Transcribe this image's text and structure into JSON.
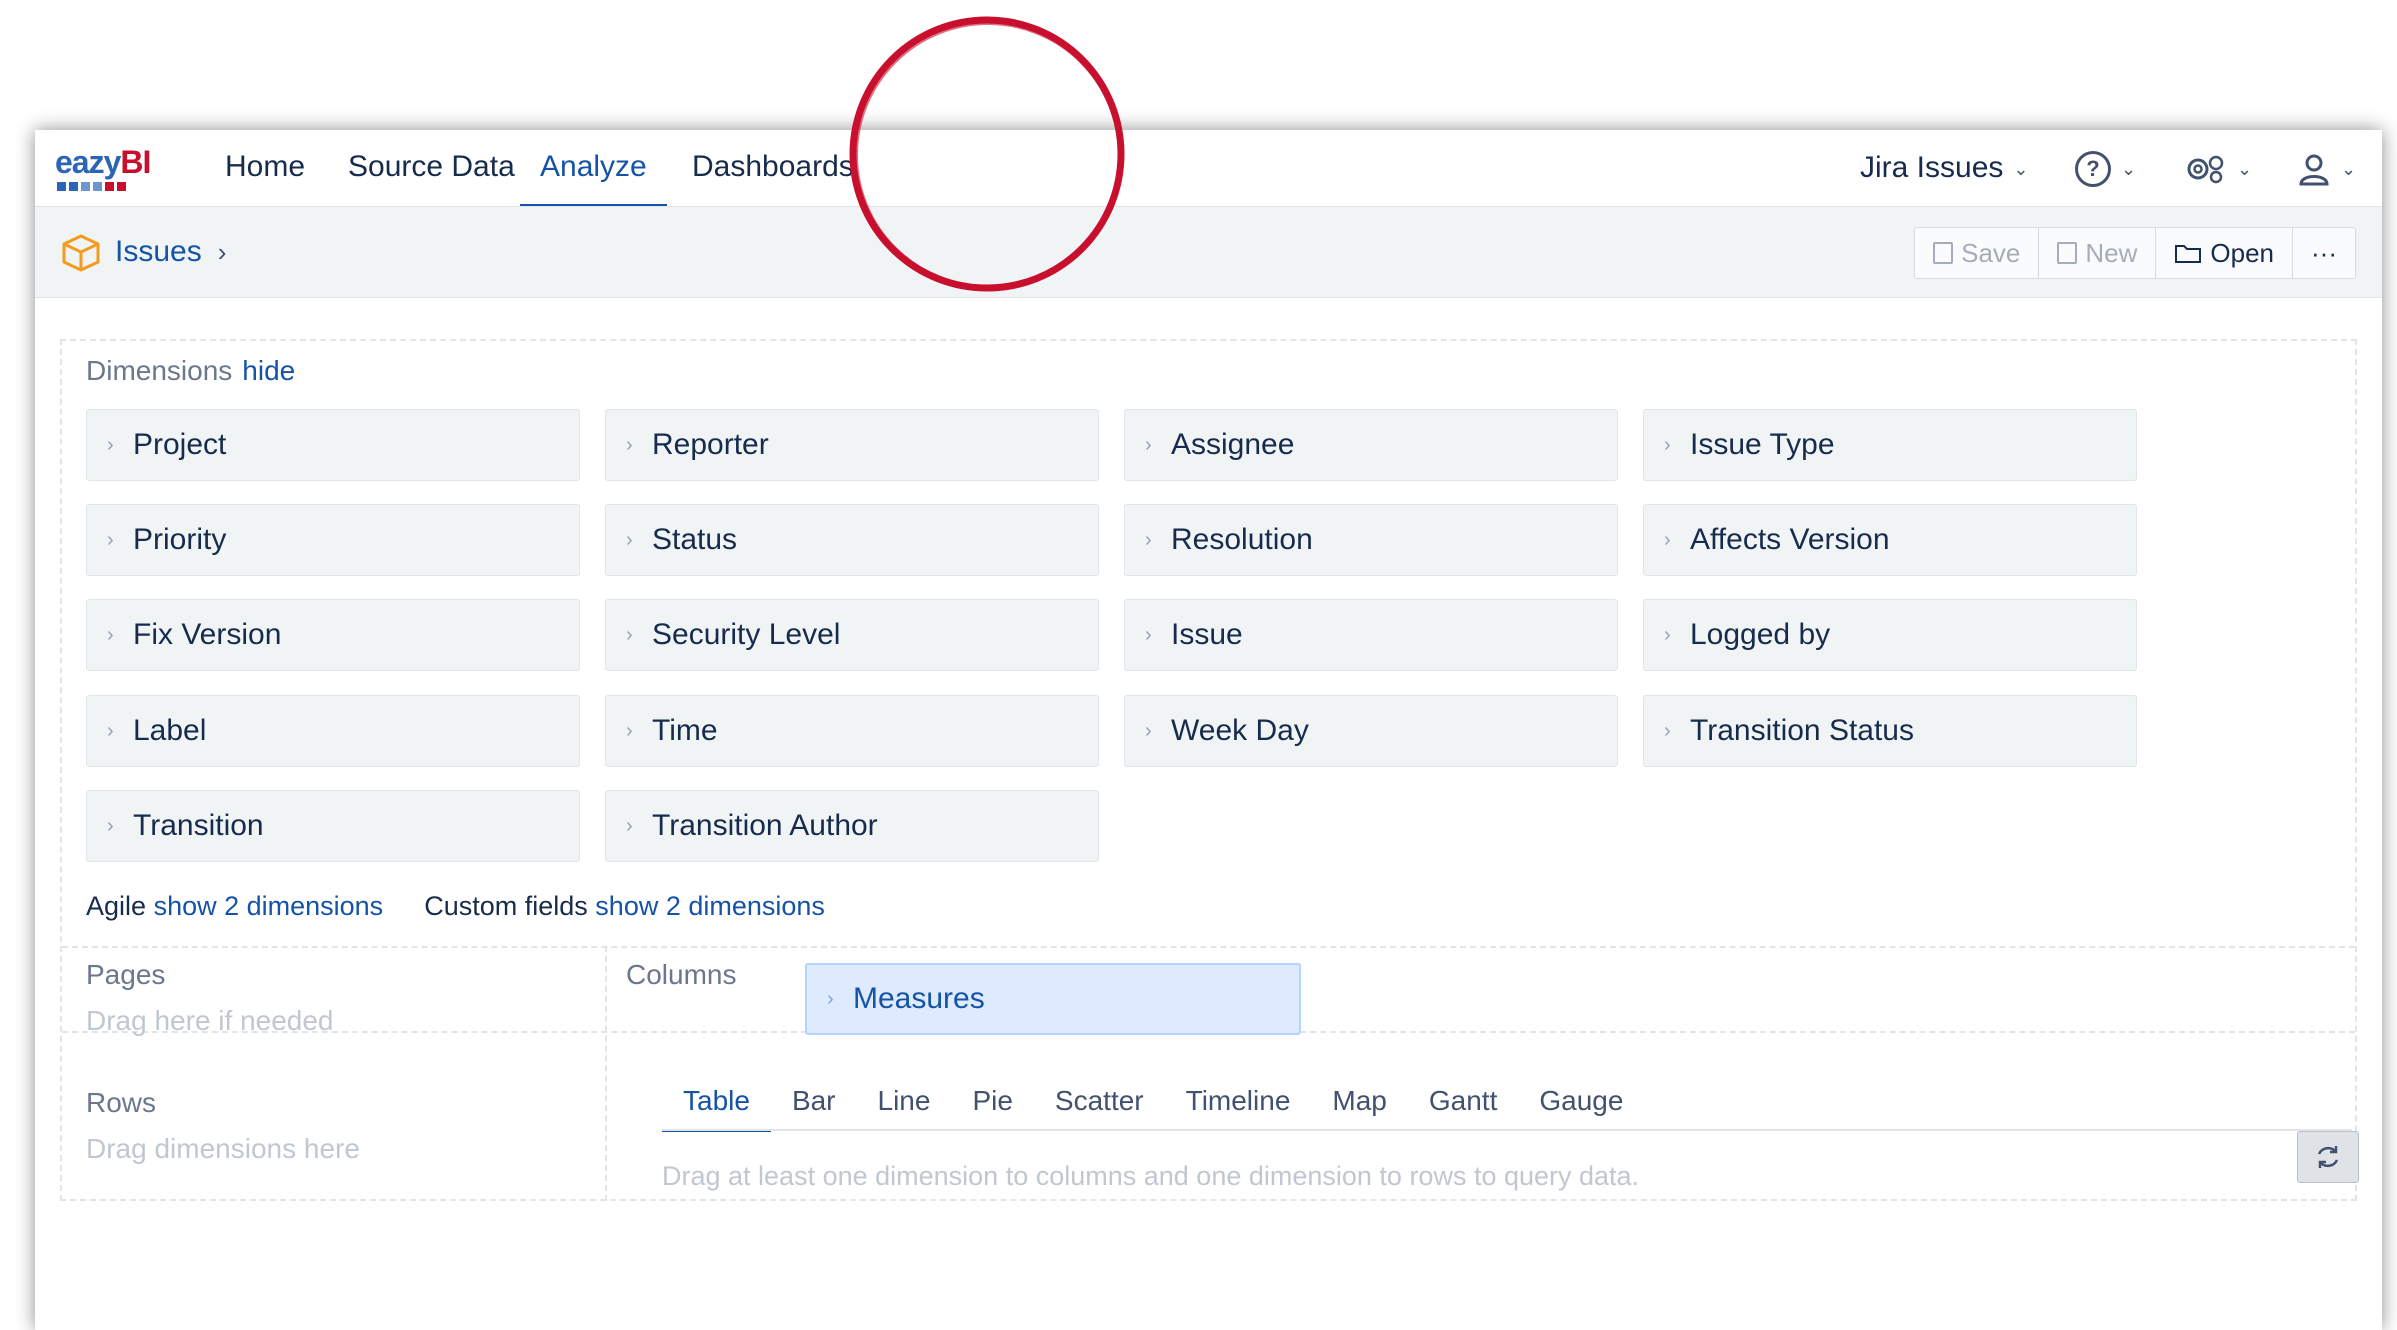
{
  "nav": {
    "logo_text_1": "ea",
    "logo_text_2": "zy",
    "logo_text_3": "BI",
    "items": [
      "Home",
      "Source Data",
      "Analyze",
      "Dashboards"
    ],
    "active": "Analyze",
    "source_selector": "Jira Issues",
    "help_icon": "help-circle-icon",
    "settings_icon": "gear-icon",
    "user_icon": "user-icon"
  },
  "breadcrumb": {
    "cube_label": "Issues",
    "cube_icon": "cube-icon"
  },
  "toolbar": {
    "save": "Save",
    "new": "New",
    "open": "Open",
    "more": "···"
  },
  "dimensions": {
    "title": "Dimensions",
    "hide_link": "hide",
    "items": [
      "Project",
      "Reporter",
      "Assignee",
      "Issue Type",
      "Priority",
      "Status",
      "Resolution",
      "Affects Version",
      "Fix Version",
      "Security Level",
      "Issue",
      "Logged by",
      "Label",
      "Time",
      "Week Day",
      "Transition Status",
      "Transition",
      "Transition Author"
    ],
    "agile_label": "Agile",
    "agile_link": "show 2 dimensions",
    "custom_label": "Custom fields",
    "custom_link": "show 2 dimensions"
  },
  "pages": {
    "title": "Pages",
    "hint": "Drag here if needed"
  },
  "columns": {
    "title": "Columns",
    "measures": "Measures"
  },
  "rows": {
    "title": "Rows",
    "hint": "Drag dimensions here"
  },
  "view_tabs": [
    "Table",
    "Bar",
    "Line",
    "Pie",
    "Scatter",
    "Timeline",
    "Map",
    "Gantt",
    "Gauge"
  ],
  "active_tab": "Table",
  "query_hint": "Drag at least one dimension to columns and one dimension to rows to query data.",
  "colors": {
    "accent": "#1553a6",
    "brand_red": "#c8102e",
    "ring": "#c8102e"
  }
}
